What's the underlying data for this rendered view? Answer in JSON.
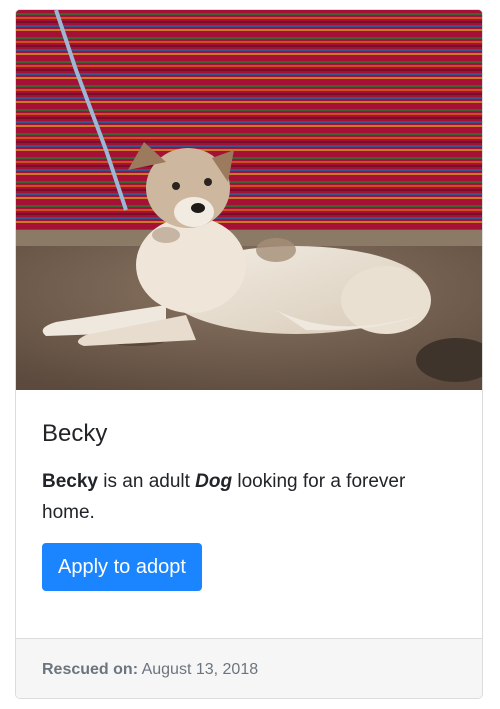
{
  "card": {
    "image_alt": "Photo of Becky, a tan and white dog lying in front of a striped blanket",
    "title": "Becky",
    "description": {
      "name": "Becky",
      "text_1": " is an adult ",
      "species": "Dog",
      "text_2": " looking for a forever home."
    },
    "button_label": "Apply to adopt",
    "footer": {
      "label": "Rescued on:",
      "date": "August 13, 2018"
    }
  },
  "colors": {
    "button": "#1a85ff",
    "footer_bg": "#f6f6f7",
    "text": "#212529",
    "muted": "#6c757d"
  }
}
